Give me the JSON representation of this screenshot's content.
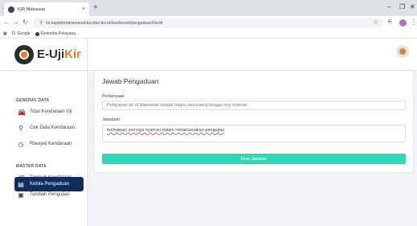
{
  "browser": {
    "tab_title": "KIR Makassar",
    "tab_close": "×",
    "new_tab": "+",
    "url": "kir.kappdomtelamanahkendari.biz.id/dashboard/pengaduan/6/edit",
    "bookmarks": [
      {
        "label": "Google"
      },
      {
        "label": "Elektroba Pelayana..."
      }
    ]
  },
  "brand": {
    "name_part1": "E-Uji",
    "name_part2": "Kir"
  },
  "sidebar": {
    "section_general": "GENERAL DATA",
    "section_master": "MASTER DATA",
    "items": [
      {
        "label": "Total Kendaraan Uji",
        "icon": "car-icon"
      },
      {
        "label": "Cek Data Kendaraan",
        "icon": "search-icon"
      },
      {
        "label": "Riwayat Kendaraan",
        "icon": "history-icon"
      },
      {
        "label": "Tambah Kendaraan",
        "icon": "car-icon"
      },
      {
        "label": "Tambah Pengujian",
        "icon": "calendar-icon"
      },
      {
        "label": "Kelola Pengaduan",
        "icon": "clipboard-icon",
        "active": true
      }
    ]
  },
  "form": {
    "title": "Jawab Pengaduan",
    "question_label": "Pertanyaan",
    "question_value": "Pelayanan kir di Makassar sangat bagus dan ruang tunggu nya nyaman",
    "answer_label": "Jawaban",
    "answer_value": "terimakasi semoga nyaman dalam melaksanakan pengujian",
    "submit_label": "Kirim Jawaban"
  }
}
